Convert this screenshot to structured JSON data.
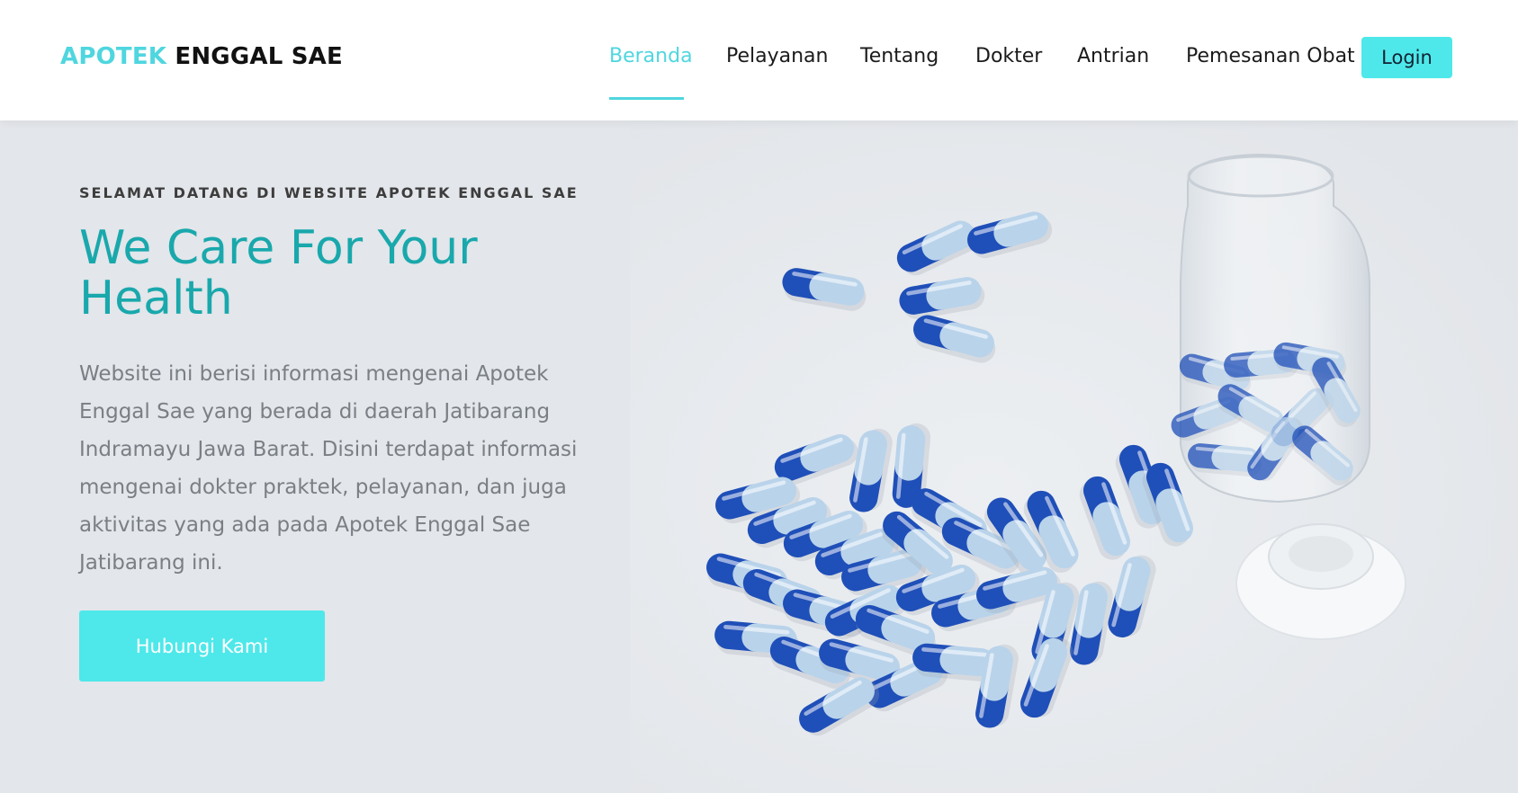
{
  "brand": {
    "part1": "APOTEK",
    "part2": "ENGGAL SAE"
  },
  "nav": {
    "items": [
      {
        "label": "Beranda",
        "active": true
      },
      {
        "label": "Pelayanan",
        "active": false
      },
      {
        "label": "Tentang",
        "active": false
      },
      {
        "label": "Dokter",
        "active": false
      },
      {
        "label": "Antrian",
        "active": false
      },
      {
        "label": "Pemesanan Obat",
        "active": false
      }
    ],
    "login_label": "Login"
  },
  "hero": {
    "eyebrow": "SELAMAT DATANG DI WEBSITE APOTEK ENGGAL SAE",
    "title": "We Care For Your Health",
    "description": "Website ini berisi informasi mengenai Apotek Enggal Sae yang berada di daerah Jatibarang Indramayu Jawa Barat. Disini terdapat informasi mengenai dokter praktek, pelayanan, dan juga aktivitas yang ada pada Apotek Enggal Sae Jatibarang ini.",
    "cta_label": "Hubungi Kami"
  },
  "colors": {
    "accent": "#4fd6df",
    "button": "#4ee8ea",
    "title": "#19a8ac",
    "capsule_dark": "#1f4fb8",
    "capsule_light": "#b9d3ea",
    "background": "#e3e6ea"
  },
  "icons": {
    "hero_image": "capsules-and-jar-image"
  }
}
